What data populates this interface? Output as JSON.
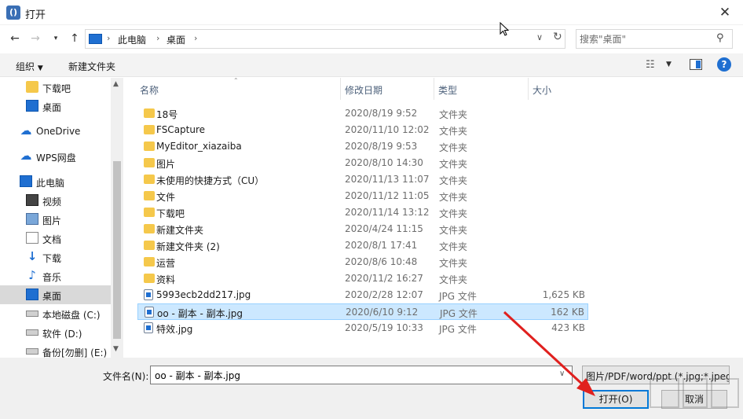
{
  "window": {
    "title": "打开",
    "app_icon": "app-logo-icon",
    "close_glyph": "✕"
  },
  "nav": {
    "path": [
      "此电脑",
      "桌面"
    ],
    "search_placeholder": "搜索\"桌面\""
  },
  "toolbar": {
    "organize": "组织",
    "new_folder": "新建文件夹"
  },
  "sidebar": [
    {
      "label": "下载吧",
      "icon": "folder-icon",
      "selected": false
    },
    {
      "label": "桌面",
      "icon": "desktop-icon",
      "selected": false
    },
    {
      "label": "OneDrive",
      "icon": "cloud-icon",
      "selected": false
    },
    {
      "label": "WPS网盘",
      "icon": "cloud-icon",
      "selected": false
    },
    {
      "label": "此电脑",
      "icon": "pc-icon",
      "selected": false
    },
    {
      "label": "视频",
      "icon": "video-icon",
      "selected": false
    },
    {
      "label": "图片",
      "icon": "picture-icon",
      "selected": false
    },
    {
      "label": "文档",
      "icon": "document-icon",
      "selected": false
    },
    {
      "label": "下载",
      "icon": "download-icon",
      "selected": false
    },
    {
      "label": "音乐",
      "icon": "music-icon",
      "selected": false
    },
    {
      "label": "桌面",
      "icon": "desktop-icon",
      "selected": true
    },
    {
      "label": "本地磁盘 (C:)",
      "icon": "drive-icon",
      "selected": false
    },
    {
      "label": "软件 (D:)",
      "icon": "drive-icon",
      "selected": false
    },
    {
      "label": "备份[勿删] (E:)",
      "icon": "drive-icon",
      "selected": false
    }
  ],
  "columns": {
    "name": "名称",
    "date": "修改日期",
    "type": "类型",
    "size": "大小"
  },
  "files": [
    {
      "name": "18号",
      "date": "2020/8/19 9:52",
      "type": "文件夹",
      "size": "",
      "kind": "folder"
    },
    {
      "name": "FSCapture",
      "date": "2020/11/10 12:02",
      "type": "文件夹",
      "size": "",
      "kind": "folder"
    },
    {
      "name": "MyEditor_xiazaiba",
      "date": "2020/8/19 9:53",
      "type": "文件夹",
      "size": "",
      "kind": "folder"
    },
    {
      "name": "图片",
      "date": "2020/8/10 14:30",
      "type": "文件夹",
      "size": "",
      "kind": "folder"
    },
    {
      "name": "未使用的快捷方式（CU）",
      "date": "2020/11/13 11:07",
      "type": "文件夹",
      "size": "",
      "kind": "folder"
    },
    {
      "name": "文件",
      "date": "2020/11/12 11:05",
      "type": "文件夹",
      "size": "",
      "kind": "folder"
    },
    {
      "name": "下载吧",
      "date": "2020/11/14 13:12",
      "type": "文件夹",
      "size": "",
      "kind": "folder"
    },
    {
      "name": "新建文件夹",
      "date": "2020/4/24 11:15",
      "type": "文件夹",
      "size": "",
      "kind": "folder"
    },
    {
      "name": "新建文件夹 (2)",
      "date": "2020/8/1 17:41",
      "type": "文件夹",
      "size": "",
      "kind": "folder"
    },
    {
      "name": "运营",
      "date": "2020/8/6 10:48",
      "type": "文件夹",
      "size": "",
      "kind": "folder"
    },
    {
      "name": "资料",
      "date": "2020/11/2 16:27",
      "type": "文件夹",
      "size": "",
      "kind": "folder"
    },
    {
      "name": "5993ecb2dd217.jpg",
      "date": "2020/2/28 12:07",
      "type": "JPG 文件",
      "size": "1,625 KB",
      "kind": "jpg"
    },
    {
      "name": "oo - 副本 - 副本.jpg",
      "date": "2020/6/10 9:12",
      "type": "JPG 文件",
      "size": "162 KB",
      "kind": "jpg",
      "selected": true
    },
    {
      "name": "特效.jpg",
      "date": "2020/5/19 10:33",
      "type": "JPG 文件",
      "size": "423 KB",
      "kind": "jpg"
    }
  ],
  "bottom": {
    "filename_label": "文件名(N):",
    "filename_value": "oo - 副本 - 副本.jpg",
    "filter": "图片/PDF/word/ppt (*.jpg;*.jpeg",
    "open_button": "打开(O)",
    "cancel_button": "取消"
  },
  "colors": {
    "accent": "#0078d7",
    "selection": "#cce8ff",
    "folder": "#f5c84b",
    "annotation_arrow": "#e0201e"
  }
}
